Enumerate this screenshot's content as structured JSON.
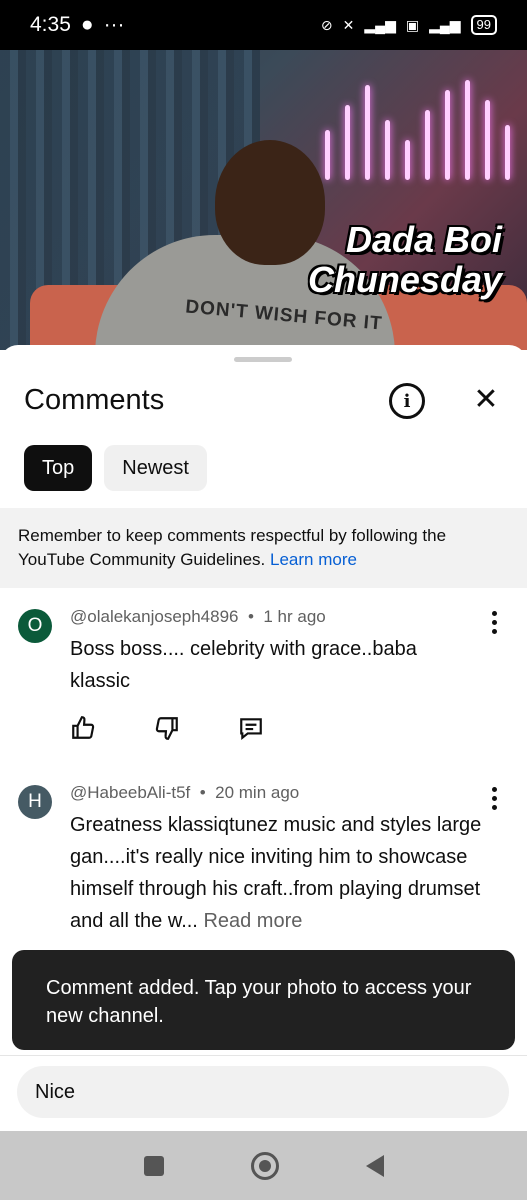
{
  "status_bar": {
    "time": "4:35",
    "battery": "99"
  },
  "video": {
    "overlay_line1": "Dada Boi",
    "overlay_line2": "Chunesday",
    "shirt_text": "DON'T WISH FOR IT"
  },
  "comments_panel": {
    "title": "Comments",
    "filters": [
      {
        "label": "Top",
        "active": true
      },
      {
        "label": "Newest",
        "active": false
      }
    ],
    "notice_text": "Remember to keep comments respectful by following the YouTube Community Guidelines.",
    "notice_link": "Learn more",
    "comments": [
      {
        "avatar_letter": "O",
        "avatar_color": "#0b5a3a",
        "author": "@olalekanjoseph4896",
        "time": "1 hr ago",
        "text": "Boss boss.... celebrity with grace..baba klassic"
      },
      {
        "avatar_letter": "H",
        "avatar_color": "#455a64",
        "author": "@HabeebAli-t5f",
        "time": "20 min ago",
        "text": "Greatness klassiqtunez music and styles large gan....it's really nice inviting him to showcase himself through his craft..from playing drumset and all the w...",
        "read_more": "Read more"
      }
    ],
    "toast": "Comment added. Tap your photo to access your new channel.",
    "input_value": "Nice"
  }
}
